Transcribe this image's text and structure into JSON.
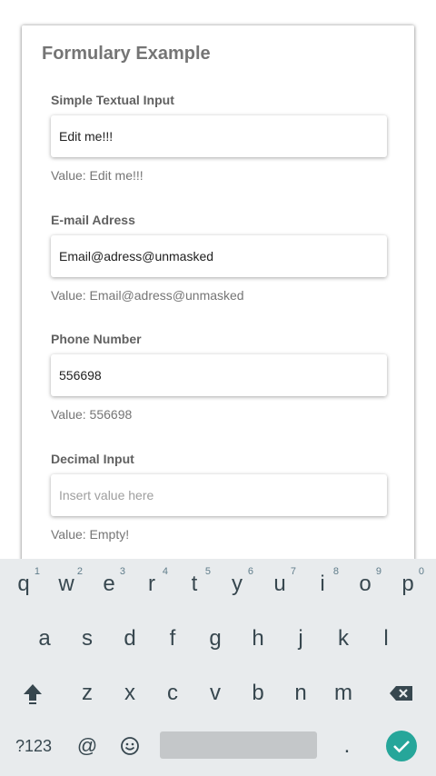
{
  "form": {
    "title": "Formulary Example",
    "fields": [
      {
        "label": "Simple Textual Input",
        "input": "Edit me!!!",
        "value": "Value: Edit me!!!"
      },
      {
        "label": "E-mail Adress",
        "input": "Email@adress@unmasked",
        "value": "Value: Email@adress@unmasked"
      },
      {
        "label": "Phone Number",
        "input": "556698",
        "value": "Value: 556698"
      },
      {
        "label": "Decimal Input",
        "placeholder": "Insert value here",
        "value": "Value: Empty!"
      }
    ]
  },
  "keyboard": {
    "row1": [
      "q",
      "w",
      "e",
      "r",
      "t",
      "y",
      "u",
      "i",
      "o",
      "p"
    ],
    "row1_hints": [
      "1",
      "2",
      "3",
      "4",
      "5",
      "6",
      "7",
      "8",
      "9",
      "0"
    ],
    "row2": [
      "a",
      "s",
      "d",
      "f",
      "g",
      "h",
      "j",
      "k",
      "l"
    ],
    "row3": [
      "z",
      "x",
      "c",
      "v",
      "b",
      "n",
      "m"
    ],
    "sym_label": "?123",
    "at_label": "@",
    "period_label": ".",
    "accent_color": "#26a69a"
  }
}
